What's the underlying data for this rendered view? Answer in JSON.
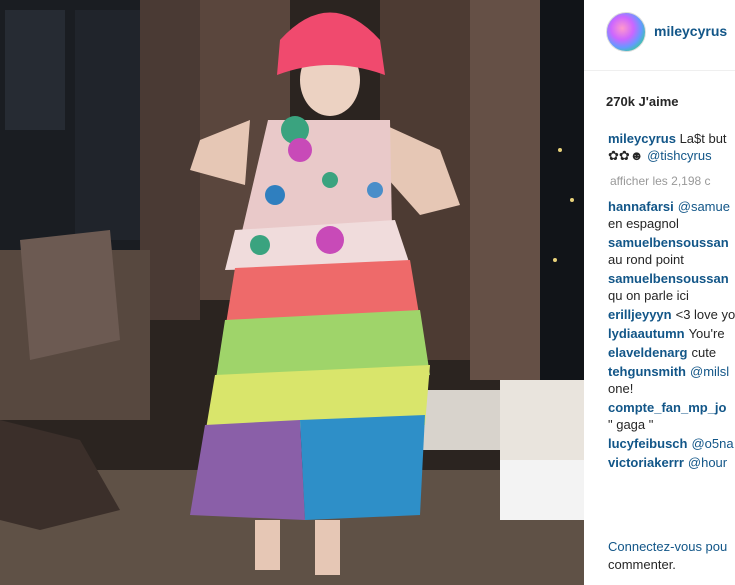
{
  "post": {
    "username": "mileycyrus",
    "likes": "270k J'aime",
    "caption_user": "mileycyrus",
    "caption_text": "La$t but",
    "caption_line2_emoji": "✿✿☻",
    "caption_mention": "@tishcyrus",
    "view_all": "afficher les 2,198 c",
    "comments": [
      {
        "user": "hannafarsi",
        "text": "@samue",
        "cont": "en espagnol"
      },
      {
        "user": "samuelbensoussan",
        "text": "",
        "cont": "au rond point"
      },
      {
        "user": "samuelbensoussan",
        "text": "",
        "cont": "qu on parle ici"
      },
      {
        "user": "erilljeyyyn",
        "text": "<3 love yo",
        "cont": ""
      },
      {
        "user": "lydiaautumn",
        "text": "You're",
        "cont": ""
      },
      {
        "user": "elaveldenarg",
        "text": "cute",
        "cont": ""
      },
      {
        "user": "tehgunsmith",
        "text": "@milsl",
        "cont": "one!"
      },
      {
        "user": "compte_fan_mp_jo",
        "text": "",
        "cont": "\" gaga \""
      },
      {
        "user": "lucyfeibusch",
        "text": "@o5na",
        "cont": ""
      },
      {
        "user": "victoriakerrr",
        "text": "@hour",
        "cont": ""
      }
    ],
    "login_link": "Connectez-vous pou",
    "login_rest": "commenter."
  },
  "colors": {
    "link": "#125688",
    "text": "#262626",
    "muted": "#999999"
  }
}
